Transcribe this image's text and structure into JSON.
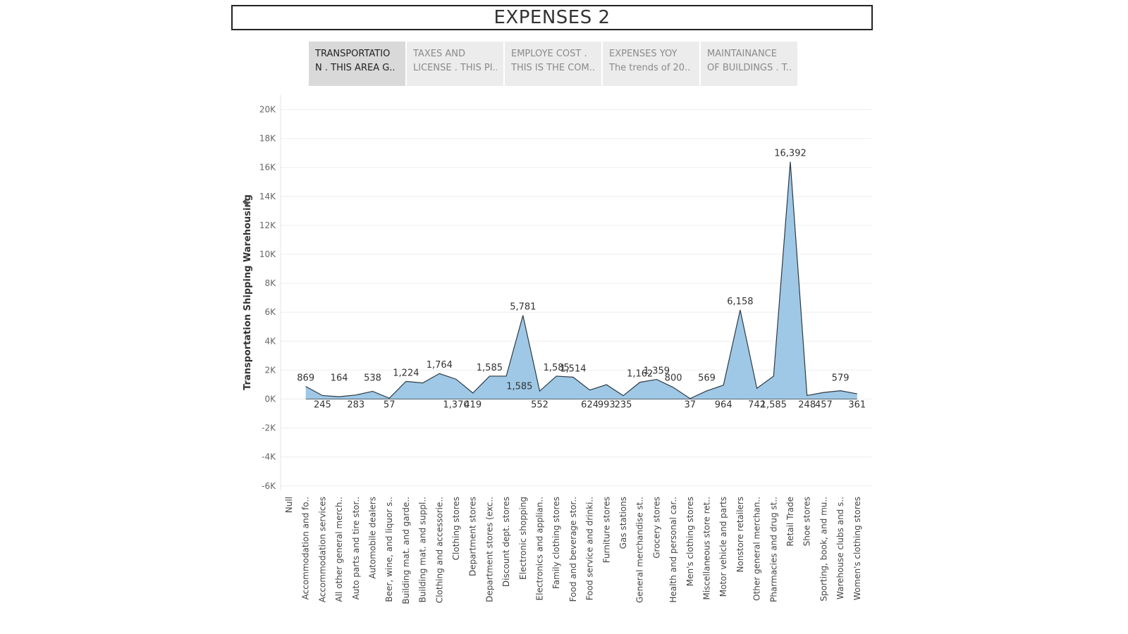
{
  "page": {
    "title": "EXPENSES 2"
  },
  "tabs": [
    {
      "line1": "TRANSPORTATIO",
      "line2": "N . THIS AREA G..",
      "active": true
    },
    {
      "line1": "TAXES AND",
      "line2": "LICENSE . THIS PI..",
      "active": false
    },
    {
      "line1": "EMPLOYE COST .",
      "line2": "THIS IS THE COM..",
      "active": false
    },
    {
      "line1": "EXPENSES YOY",
      "line2": "The trends of 20..",
      "active": false
    },
    {
      "line1": "MAINTAINANCE",
      "line2": "OF BUILDINGS . T..",
      "active": false
    }
  ],
  "icons": {
    "axis_pin": "pin-icon"
  },
  "colors": {
    "area_fill": "#9fc8e6",
    "area_stroke": "#2d3a44",
    "gridline": "#eeeeee"
  },
  "chart_data": {
    "type": "area",
    "title": "",
    "xlabel": "",
    "ylabel": "Transportation Shipping Warehousing",
    "ylim": [
      -6000,
      20000
    ],
    "yticks": [
      20000,
      18000,
      16000,
      14000,
      12000,
      10000,
      8000,
      6000,
      4000,
      2000,
      0,
      -2000,
      -4000,
      -6000
    ],
    "ytick_labels": [
      "20K",
      "18K",
      "16K",
      "14K",
      "12K",
      "10K",
      "8K",
      "6K",
      "4K",
      "2K",
      "0K",
      "-2K",
      "-4K",
      "-6K"
    ],
    "grid": true,
    "categories": [
      "Null",
      "Accommodation and fo..",
      "Accommodation services",
      "All other general merch..",
      "Auto parts and tire stor..",
      "Automobile dealers",
      "Beer, wine, and liquor s..",
      "Building mat. and garde..",
      "Building mat. and suppl..",
      "Clothing and accessorie..",
      "Clothing stores",
      "Department stores",
      "Department stores (exc..",
      "Discount dept. stores",
      "Electronic shopping",
      "Electronics and applian..",
      "Family clothing stores",
      "Food and beverage stor..",
      "Food service and drinki..",
      "Furniture stores",
      "Gas stations",
      "General merchandise st..",
      "Grocery stores",
      "Health and personal car..",
      "Men's clothing stores",
      "Miscellaneous store ret..",
      "Motor vehicle and parts",
      "Nonstore retailers",
      "Other general merchan..",
      "Pharmacies and drug st..",
      "Retail Trade",
      "Shoe stores",
      "Sporting, book, and mu..",
      "Warehouse clubs and s..",
      "Women's clothing stores"
    ],
    "values": [
      869,
      245,
      164,
      283,
      538,
      57,
      1224,
      1115,
      1764,
      1370,
      419,
      1585,
      1585,
      5781,
      552,
      1585,
      1514,
      624,
      993,
      235,
      1162,
      1359,
      800,
      37,
      569,
      964,
      6158,
      742,
      1585,
      16392,
      248,
      457,
      579,
      361
    ],
    "value_labels": [
      "869",
      "245",
      "164",
      "283",
      "538",
      "57",
      "1,224",
      "",
      "1,764",
      "1,370",
      "419",
      "1,585",
      "",
      "5,781",
      "552",
      "1,585",
      "1,514",
      "624",
      "993",
      "235",
      "1,162",
      "1,359",
      "800",
      "37",
      "569",
      "964",
      "6,158",
      "742",
      "1,585",
      "16,392",
      "248",
      "457",
      "579",
      "361"
    ],
    "label_positions": [
      "above",
      "below",
      "above",
      "below",
      "above",
      "below",
      "above",
      "none",
      "above",
      "below",
      "below",
      "above",
      "none",
      "above",
      "below",
      "above",
      "above",
      "below",
      "below",
      "below",
      "above",
      "above",
      "above",
      "below",
      "above",
      "below",
      "above",
      "below",
      "below",
      "above",
      "below",
      "below",
      "above",
      "below"
    ],
    "extra_labels": [
      {
        "text": "1,585",
        "category_index": 13,
        "value": 1585
      }
    ]
  }
}
